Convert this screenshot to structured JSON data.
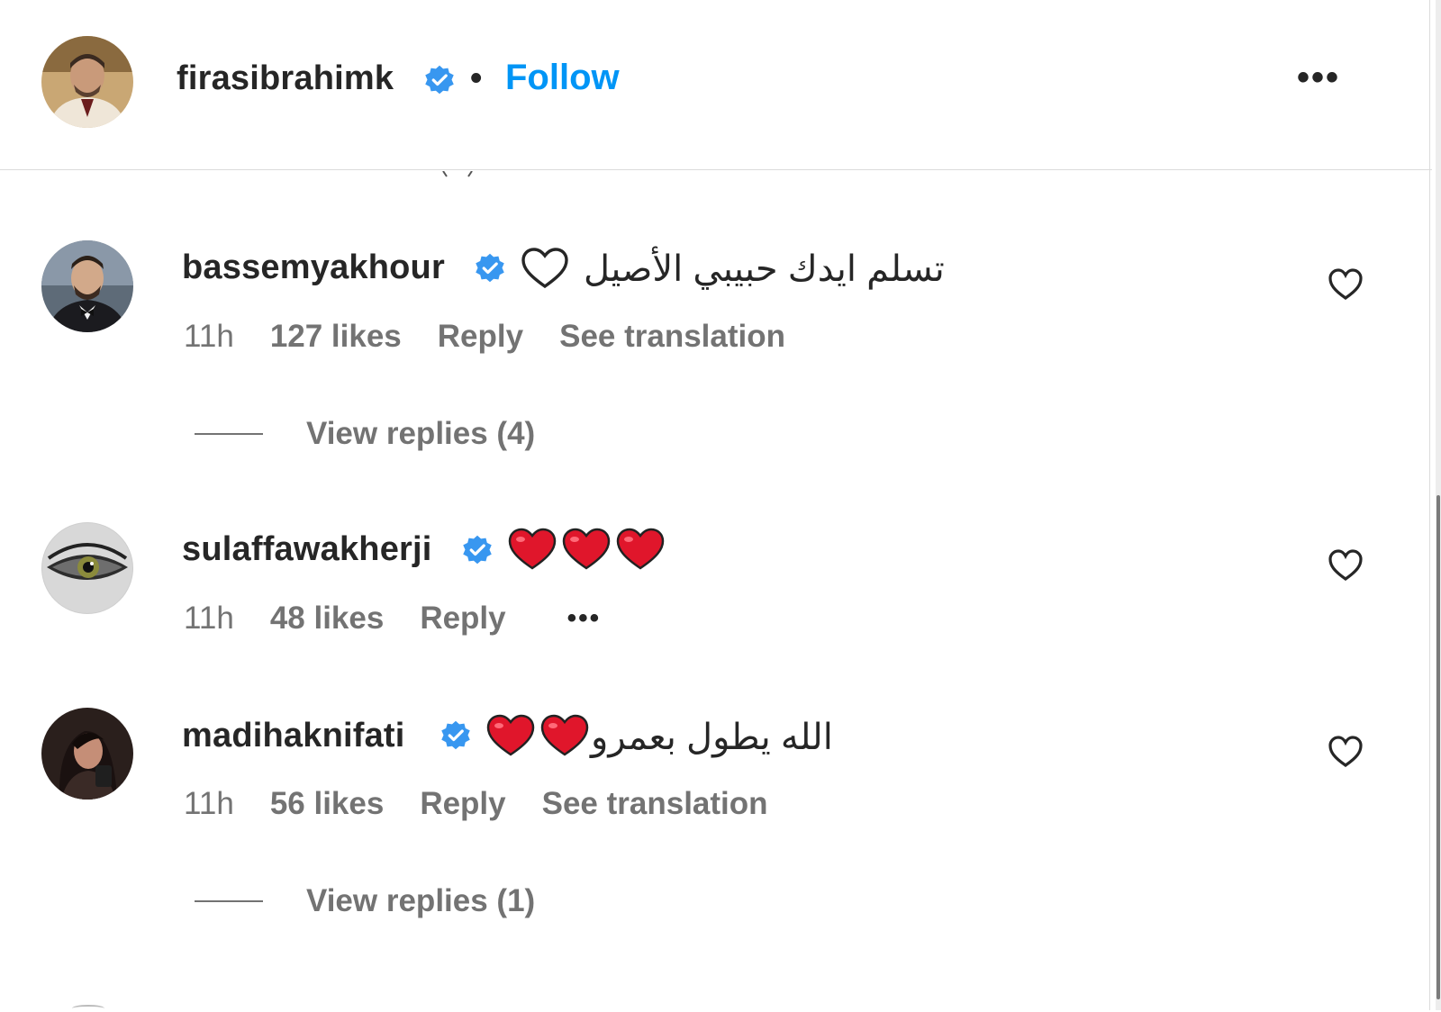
{
  "post_header": {
    "username": "firasibrahimk",
    "separator": "•",
    "follow_label": "Follow",
    "more_label": "•••"
  },
  "comments": [
    {
      "username": "bassemyakhour",
      "text": "تسلم ايدك حبيبي الأصيل",
      "time": "11h",
      "likes": "127 likes",
      "reply_label": "Reply",
      "translate_label": "See translation",
      "view_replies": "View replies (4)"
    },
    {
      "username": "sulaffawakherji",
      "text": "",
      "time": "11h",
      "likes": "48 likes",
      "reply_label": "Reply",
      "more_label": "•••"
    },
    {
      "username": "madihaknifati",
      "text": "الله يطول بعمرو",
      "time": "11h",
      "likes": "56 likes",
      "reply_label": "Reply",
      "translate_label": "See translation",
      "view_replies": "View replies (1)"
    }
  ],
  "colors": {
    "accent": "#0095f6",
    "verified": "#3897f0",
    "heart_red": "#e0162b",
    "muted_text": "#737373"
  }
}
